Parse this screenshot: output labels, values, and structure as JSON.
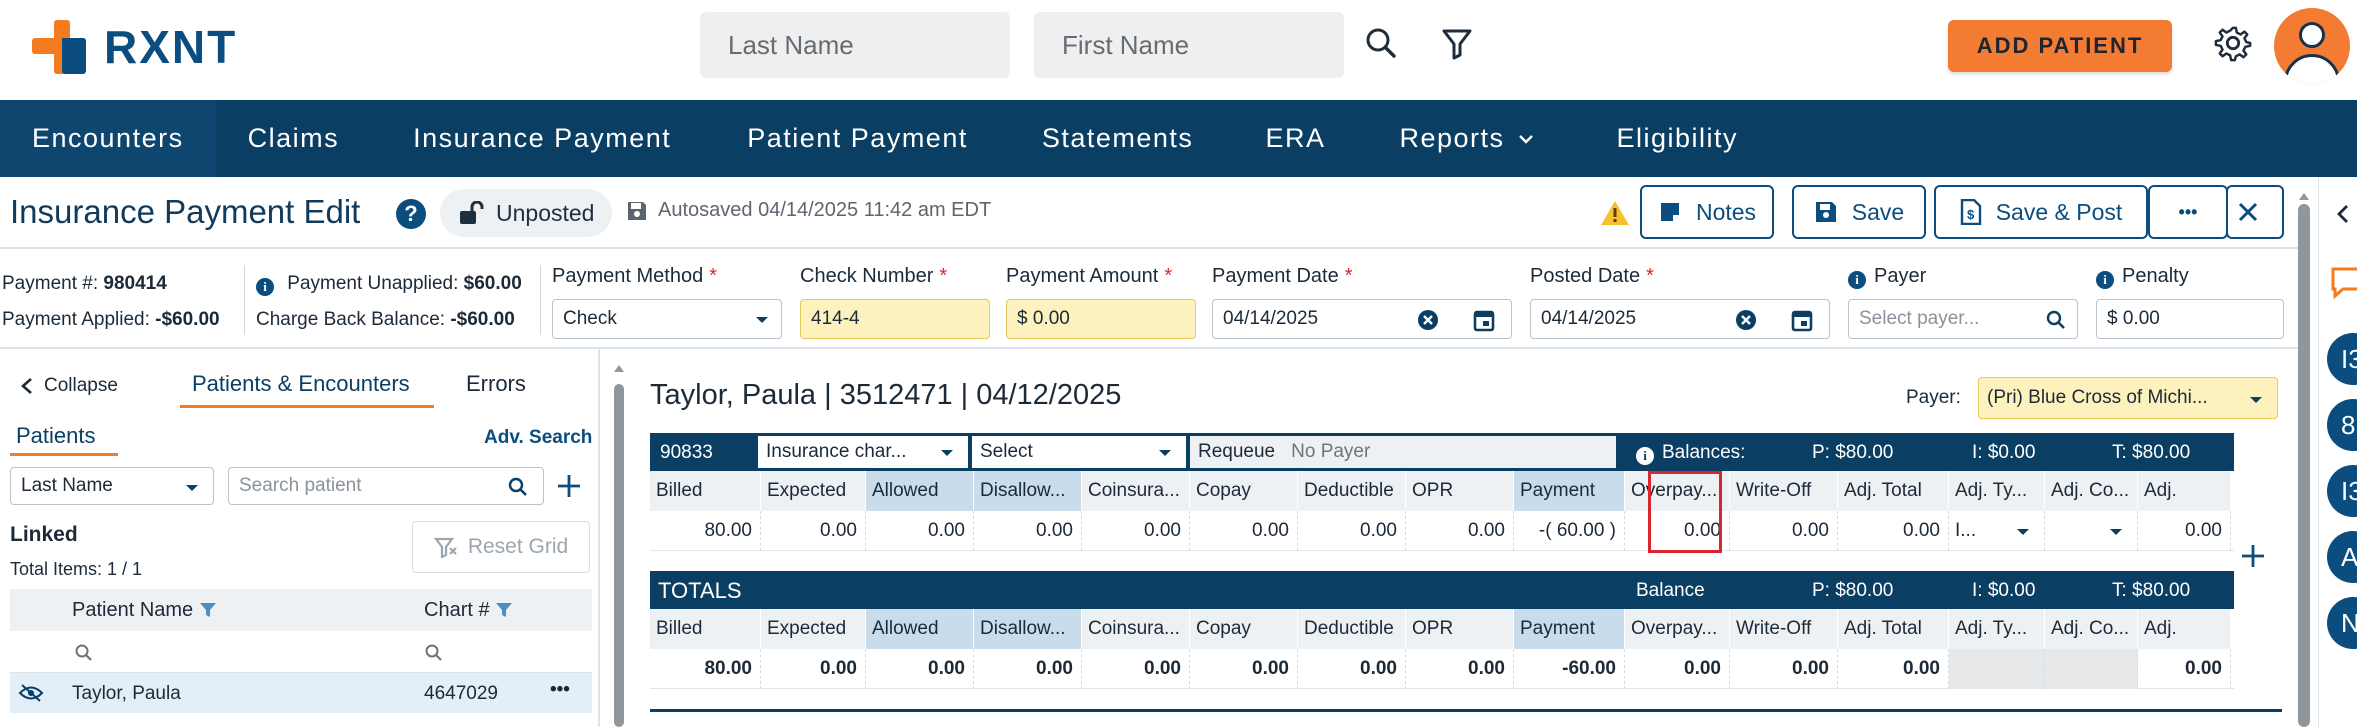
{
  "header": {
    "logo_text": "RXNT",
    "last_name_placeholder": "Last Name",
    "first_name_placeholder": "First Name",
    "add_patient_label": "ADD PATIENT"
  },
  "nav": {
    "items": [
      "Encounters",
      "Claims",
      "Insurance Payment",
      "Patient Payment",
      "Statements",
      "ERA",
      "Reports",
      "Eligibility"
    ]
  },
  "title_row": {
    "title": "Insurance Payment Edit",
    "help": "?",
    "status": "Unposted",
    "autosave": "Autosaved 04/14/2025 11:42 am EDT",
    "notes_label": "Notes",
    "save_label": "Save",
    "save_post_label": "Save & Post",
    "more_label": "•••"
  },
  "payment": {
    "payment_no_label": "Payment #:",
    "payment_no": "980414",
    "applied_label": "Payment Applied:",
    "applied": "-$60.00",
    "unapplied_label": "Payment Unapplied:",
    "unapplied": "$60.00",
    "chargeback_label": "Charge Back Balance:",
    "chargeback": "-$60.00",
    "method_label": "Payment Method",
    "method_value": "Check",
    "check_label": "Check Number",
    "check_value": "414-4",
    "amount_label": "Payment Amount",
    "amount_value": "$ 0.00",
    "payment_date_label": "Payment Date",
    "payment_date_value": "04/14/2025",
    "posted_date_label": "Posted Date",
    "posted_date_value": "04/14/2025",
    "payer_label": "Payer",
    "payer_placeholder": "Select payer...",
    "penalty_label": "Penalty",
    "penalty_value": "$ 0.00",
    "required_mark": "*"
  },
  "left_panel": {
    "collapse_label": "Collapse",
    "tab_patients_encounters": "Patients & Encounters",
    "tab_errors": "Errors",
    "patients_label": "Patients",
    "adv_search": "Adv. Search",
    "search_by": "Last Name",
    "search_placeholder": "Search patient",
    "linked_label": "Linked",
    "total_items": "Total Items: 1 / 1",
    "reset_grid": "Reset Grid",
    "col_patient_name": "Patient Name",
    "col_chart": "Chart #",
    "rows": [
      {
        "name": "Taylor, Paula",
        "chart": "4647029",
        "more": "•••"
      }
    ]
  },
  "encounter": {
    "title": "Taylor, Paula | 3512471 | 04/12/2025",
    "payer_label": "Payer:",
    "payer_value": "(Pri) Blue Cross of Michi...",
    "code": "90833",
    "insurance_select": "Insurance char...",
    "select_label": "Select",
    "requeue_label": "Requeue",
    "requeue_value": "No Payer",
    "balances_label": "Balances:",
    "bal_p": "P: $80.00",
    "bal_i": "I: $0.00",
    "bal_t": "T: $80.00",
    "columns": [
      "Billed",
      "Expected",
      "Allowed",
      "Disallow...",
      "Coinsura...",
      "Copay",
      "Deductible",
      "OPR",
      "Payment",
      "Overpay...",
      "Write-Off",
      "Adj. Total",
      "Adj. Ty...",
      "Adj. Co...",
      "Adj."
    ],
    "values": [
      "80.00",
      "0.00",
      "0.00",
      "0.00",
      "0.00",
      "0.00",
      "0.00",
      "0.00",
      "-( 60.00 )",
      "0.00",
      "0.00",
      "0.00",
      "I...",
      "",
      "0.00"
    ]
  },
  "totals": {
    "title": "TOTALS",
    "balance_label": "Balance",
    "bal_p": "P: $80.00",
    "bal_i": "I: $0.00",
    "bal_t": "T: $80.00",
    "columns": [
      "Billed",
      "Expected",
      "Allowed",
      "Disallow...",
      "Coinsura...",
      "Copay",
      "Deductible",
      "OPR",
      "Payment",
      "Overpay...",
      "Write-Off",
      "Adj. Total",
      "Adj. Ty...",
      "Adj. Co...",
      "Adj."
    ],
    "values": [
      "80.00",
      "0.00",
      "0.00",
      "0.00",
      "0.00",
      "0.00",
      "0.00",
      "0.00",
      "-60.00",
      "0.00",
      "0.00",
      "0.00",
      "",
      "",
      "0.00"
    ]
  },
  "right_sidebar": {
    "circles": [
      "I3",
      "8",
      "I3",
      "A",
      "N"
    ]
  },
  "colors": {
    "brand_blue": "#0b3e63",
    "brand_orange": "#f47b20",
    "highlight_red": "#d9262c",
    "required_yellow": "#fdf2bd"
  }
}
